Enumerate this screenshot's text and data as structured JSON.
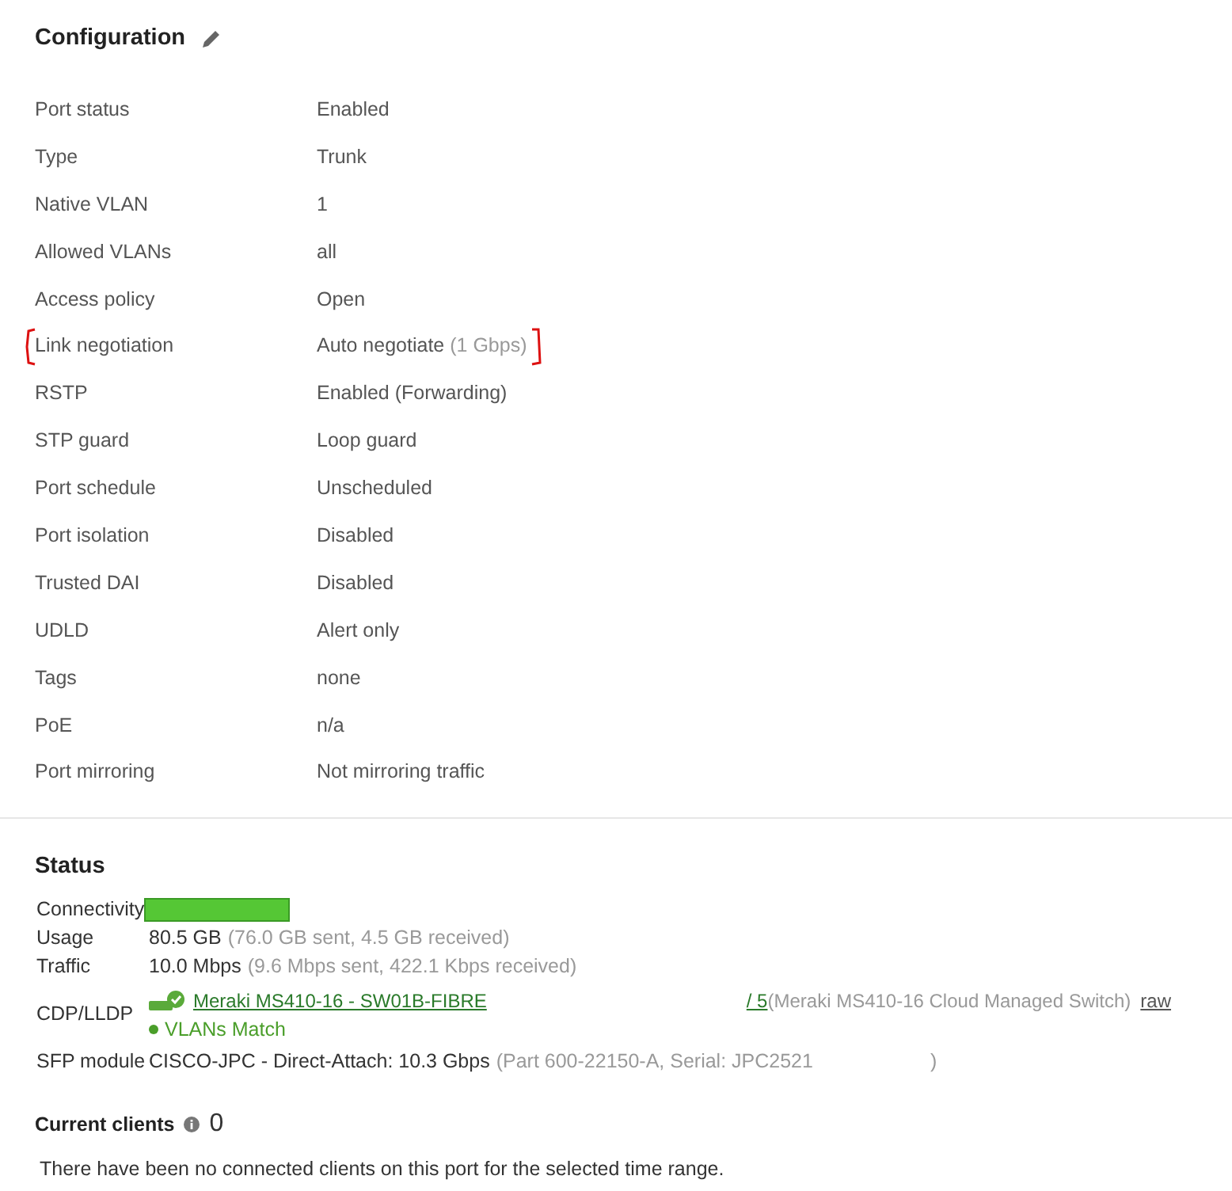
{
  "configuration": {
    "title": "Configuration",
    "rows": [
      {
        "label": "Port status",
        "value": "Enabled"
      },
      {
        "label": "Type",
        "value": "Trunk"
      },
      {
        "label": "Native VLAN",
        "value": "1"
      },
      {
        "label": "Allowed VLANs",
        "value": "all"
      },
      {
        "label": "Access policy",
        "value": "Open"
      },
      {
        "label": "Link negotiation",
        "value": "Auto negotiate",
        "detail": "(1 Gbps)",
        "highlighted": true
      },
      {
        "label": "RSTP",
        "value": "Enabled (Forwarding)"
      },
      {
        "label": "STP guard",
        "value": "Loop guard"
      },
      {
        "label": "Port schedule",
        "value": "Unscheduled"
      },
      {
        "label": "Port isolation",
        "value": "Disabled"
      },
      {
        "label": "Trusted DAI",
        "value": "Disabled"
      },
      {
        "label": "UDLD",
        "value": "Alert only"
      },
      {
        "label": "Tags",
        "value": "none"
      },
      {
        "label": "PoE",
        "value": "n/a"
      },
      {
        "label": "Port mirroring",
        "value": "Not mirroring traffic"
      }
    ]
  },
  "status": {
    "title": "Status",
    "rows": [
      {
        "kind": "bar",
        "label": "Connectivity"
      },
      {
        "kind": "text",
        "label": "Usage",
        "value": "80.5 GB",
        "detail": "(76.0 GB sent, 4.5 GB received)"
      },
      {
        "kind": "text",
        "label": "Traffic",
        "value": "10.0 Mbps",
        "detail": "(9.6 Mbps sent, 422.1 Kbps received)"
      },
      {
        "kind": "cdp",
        "label": "CDP/LLDP",
        "link": "Meraki MS410-16 - SW01B-FIBRE",
        "port": "/ 5",
        "detail": "(Meraki MS410-16 Cloud Managed Switch)",
        "raw": "raw",
        "match": "VLANs Match"
      },
      {
        "kind": "sfp",
        "label": "SFP module",
        "value": "CISCO-JPC - Direct-Attach: 10.3 Gbps",
        "detail": "(Part 600-22150-A, Serial: JPC2521",
        "tail": ")"
      }
    ]
  },
  "clients": {
    "title": "Current clients",
    "count": "0",
    "message": "There have been no connected clients on this port for the selected time range."
  }
}
